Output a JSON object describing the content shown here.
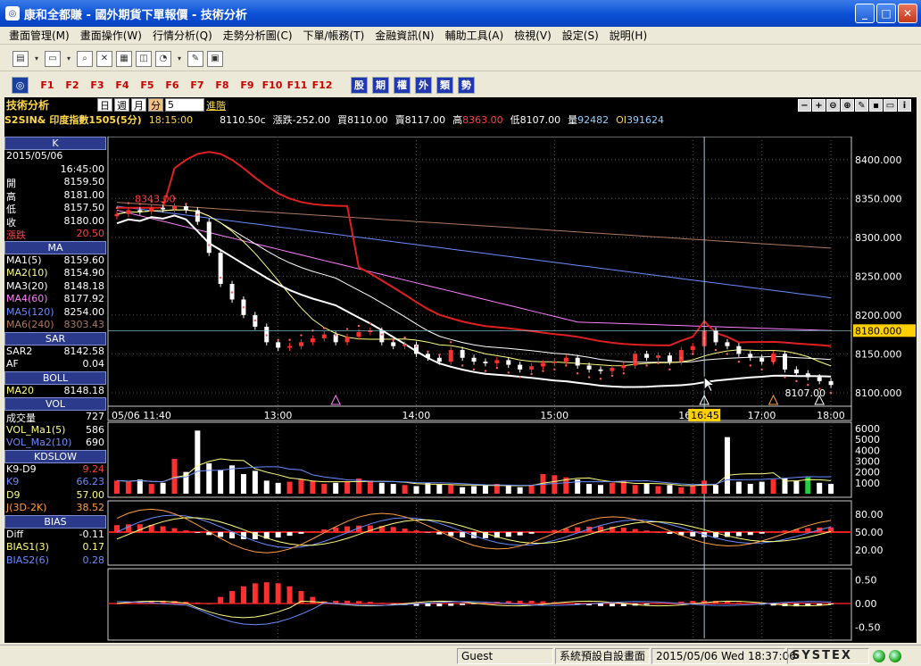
{
  "window": {
    "title": "康和全都賺 - 國外期貨下單報價 - 技術分析"
  },
  "menu": [
    "畫面管理(M)",
    "畫面操作(W)",
    "行情分析(Q)",
    "走勢分析圖(C)",
    "下單/帳務(T)",
    "金融資訊(N)",
    "輔助工具(A)",
    "檢視(V)",
    "設定(S)",
    "說明(H)"
  ],
  "toolbar": {
    "function_keys": [
      "F1",
      "F2",
      "F3",
      "F4",
      "F5",
      "F6",
      "F7",
      "F8",
      "F9",
      "F10",
      "F11",
      "F12"
    ],
    "category_buttons": [
      "股",
      "期",
      "權",
      "外",
      "類",
      "勢"
    ]
  },
  "chart_header": {
    "title": "技術分析",
    "period_day": "日",
    "period_week": "週",
    "period_month": "月",
    "period_minute": "分",
    "interval": "5",
    "advanced": "進階",
    "symbol": "S2SIN&",
    "name": "印度指數1505(5分)",
    "time": "18:15:00",
    "last": "8110.50c",
    "change": "漲跌-252.00",
    "bid": "買8110.00",
    "ask": "賣8117.00",
    "high_label": "高",
    "high": "8363.00",
    "low_label": "低",
    "low": "8107.00",
    "vol_label": "量",
    "vol": "92482",
    "oi_label": "OI",
    "oi": "391624"
  },
  "left_panel": {
    "k": {
      "title": "K",
      "date": "2015/05/06",
      "time": "16:45:00",
      "rows": [
        {
          "l": "開",
          "v": "8159.50"
        },
        {
          "l": "高",
          "v": "8181.00"
        },
        {
          "l": "低",
          "v": "8157.50"
        },
        {
          "l": "收",
          "v": "8180.00"
        },
        {
          "l": "漲跌",
          "v": "20.50"
        }
      ]
    },
    "ma": {
      "title": "MA",
      "rows": [
        {
          "l": "MA1(5)",
          "v": "8159.60"
        },
        {
          "l": "MA2(10)",
          "v": "8154.90"
        },
        {
          "l": "MA3(20)",
          "v": "8148.18"
        },
        {
          "l": "MA4(60)",
          "v": "8177.92"
        },
        {
          "l": "MA5(120)",
          "v": "8254.00"
        },
        {
          "l": "MA6(240)",
          "v": "8303.43"
        }
      ]
    },
    "sar": {
      "title": "SAR",
      "rows": [
        {
          "l": "SAR2",
          "v": "8142.58"
        },
        {
          "l": "AF",
          "v": "0.04"
        }
      ]
    },
    "boll": {
      "title": "BOLL",
      "rows": [
        {
          "l": "MA20",
          "v": "8148.18"
        }
      ]
    },
    "vol": {
      "title": "VOL",
      "rows": [
        {
          "l": "成交量",
          "v": "727"
        },
        {
          "l": "VOL_Ma1(5)",
          "v": "586"
        },
        {
          "l": "VOL_Ma2(10)",
          "v": "690"
        }
      ]
    },
    "kd": {
      "title": "KDSLOW",
      "rows": [
        {
          "l": "K9-D9",
          "v": "9.24"
        },
        {
          "l": "K9",
          "v": "66.23"
        },
        {
          "l": "D9",
          "v": "57.00"
        },
        {
          "l": "J(3D-2K)",
          "v": "38.52"
        }
      ]
    },
    "bias": {
      "title": "BIAS",
      "rows": [
        {
          "l": "Diff",
          "v": "-0.11"
        },
        {
          "l": "BIAS1(3)",
          "v": "0.17"
        },
        {
          "l": "BIAS2(6)",
          "v": "0.28"
        }
      ]
    }
  },
  "chart_data": {
    "type": "candlestick",
    "x_ticks": [
      "05/06 11:40",
      "13:00",
      "14:00",
      "15:00",
      "16:00",
      "17:00",
      "18:00"
    ],
    "crosshair_time": "16:45",
    "price_axis": [
      "8400.000",
      "8350.000",
      "8300.000",
      "8250.000",
      "8200.000",
      "8150.000",
      "8100.000"
    ],
    "price_ylim": [
      8085,
      8425
    ],
    "crosshair_price": "8180.000",
    "annotations": [
      "8343.00",
      "8107.00"
    ],
    "vol_axis": [
      "6000",
      "5000",
      "4000",
      "3000",
      "2000",
      "1000"
    ],
    "kd_axis": [
      "80.00",
      "50.00",
      "20.00"
    ],
    "bias_axis": [
      "0.50",
      "0.00",
      "-0.50"
    ],
    "close_series": [
      8330,
      8335,
      8333,
      8338,
      8336,
      8340,
      8335,
      8320,
      8280,
      8240,
      8220,
      8200,
      8185,
      8165,
      8158,
      8160,
      8165,
      8170,
      8175,
      8165,
      8172,
      8178,
      8180,
      8165,
      8160,
      8162,
      8150,
      8145,
      8140,
      8155,
      8145,
      8140,
      8138,
      8142,
      8136,
      8130,
      8134,
      8138,
      8140,
      8145,
      8135,
      8130,
      8128,
      8132,
      8135,
      8150,
      8145,
      8148,
      8140,
      8155,
      8160,
      8180,
      8165,
      8160,
      8150,
      8145,
      8140,
      8150,
      8130,
      8125,
      8120,
      8115,
      8110
    ],
    "volumes": [
      1200,
      1100,
      1300,
      900,
      1000,
      3200,
      2000,
      5800,
      2800,
      2200,
      2600,
      1800,
      2100,
      1200,
      1000,
      1100,
      1300,
      1200,
      900,
      1000,
      1100,
      1400,
      1200,
      1000,
      900,
      800,
      700,
      1000,
      900,
      800,
      600,
      700,
      800,
      900,
      700,
      600,
      800,
      1800,
      1700,
      1500,
      1300,
      900,
      800,
      1000,
      1200,
      800,
      900,
      700,
      800,
      600,
      700,
      1200,
      800,
      5200,
      1100,
      900,
      1100,
      1300,
      1400,
      1200,
      1500,
      1000,
      900
    ]
  }
}
